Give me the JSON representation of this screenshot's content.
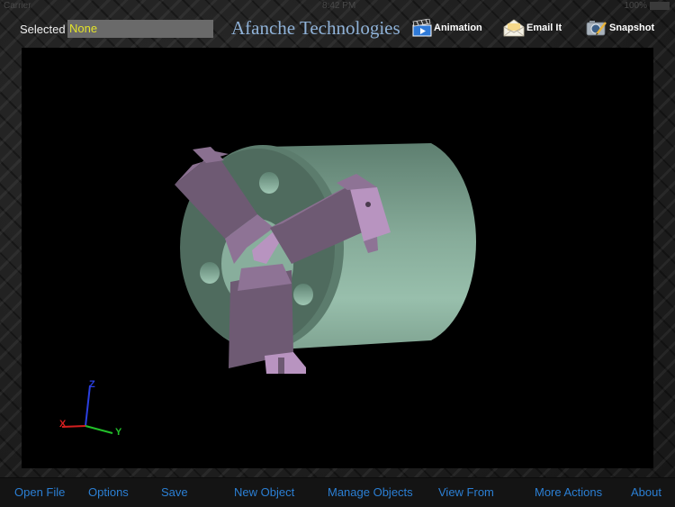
{
  "status_bar": {
    "carrier": "Carrier",
    "time": "8:42 PM",
    "battery": "100%"
  },
  "header": {
    "selected_label": "Selected",
    "selected_value": "None",
    "brand": "Afanche Technologies",
    "buttons": [
      {
        "label": "Animation",
        "icon": "clapperboard-icon"
      },
      {
        "label": "Email It",
        "icon": "envelope-icon"
      },
      {
        "label": "Snapshot",
        "icon": "camera-icon"
      }
    ]
  },
  "viewport": {
    "background": "#000000",
    "model_colors": {
      "body": "#8fb5a3",
      "face": "#4f6b5e",
      "jaw": "#6e5a73",
      "jaw_light": "#b894c0"
    },
    "axes": {
      "x_label": "X",
      "y_label": "Y",
      "z_label": "Z",
      "x_color": "#d41f1f",
      "y_color": "#22c02a",
      "z_color": "#2a3fe0"
    }
  },
  "toolbar": {
    "items": [
      {
        "label": "Open File"
      },
      {
        "label": "Options"
      },
      {
        "label": "Save"
      },
      {
        "label": "New Object"
      },
      {
        "label": "Manage Objects"
      },
      {
        "label": "View From"
      },
      {
        "label": "More Actions"
      },
      {
        "label": "About"
      }
    ],
    "link_color": "#2b7fd4"
  }
}
